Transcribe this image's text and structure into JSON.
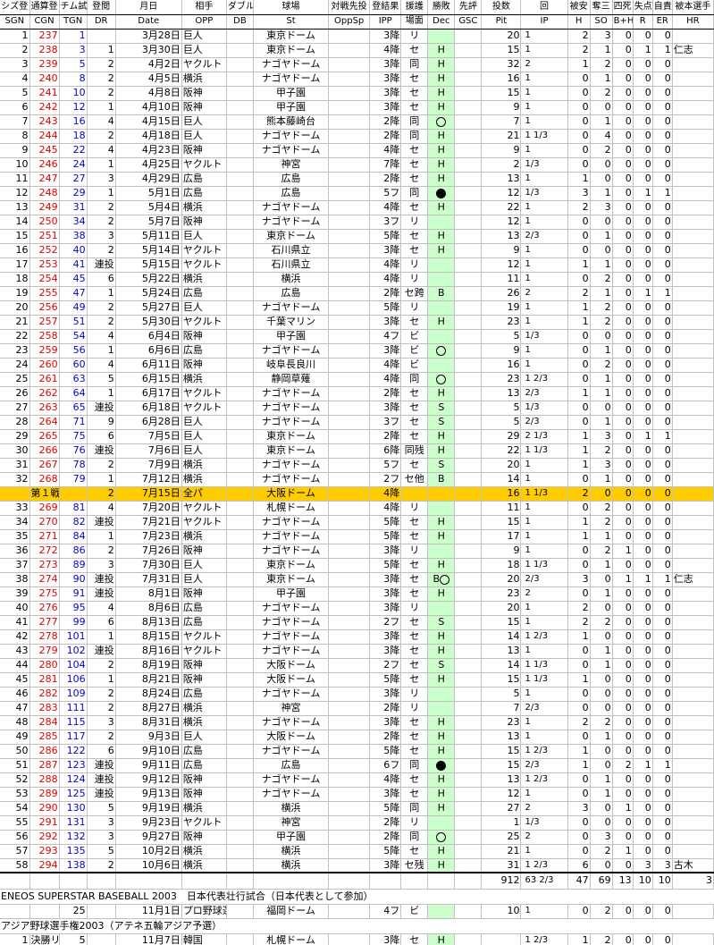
{
  "headers_top": [
    "シズ登",
    "通算登",
    "チム試",
    "登閲",
    "月日",
    "相手",
    "ダブル",
    "球場",
    "対戦先投",
    "登結果",
    "援護",
    "勝敗",
    "先評",
    "投数",
    "回",
    "被安",
    "奪三",
    "四死",
    "失点",
    "自責",
    "被本選手"
  ],
  "headers_bottom": [
    "SGN",
    "CGN",
    "TGN",
    "DR",
    "Date",
    "OPP",
    "DB",
    "St",
    "OppSp",
    "IPP",
    "場面",
    "Dec",
    "GSC",
    "Pit",
    "IP",
    "H",
    "SO",
    "B+H",
    "R",
    "ER",
    "HR"
  ],
  "rows": [
    [
      "1",
      "237",
      "1",
      "",
      "3月28日",
      "巨人",
      "",
      "東京ドーム",
      "",
      "3降",
      "リ",
      "",
      "",
      "20",
      "1",
      "2",
      "3",
      "0",
      "0",
      "0",
      ""
    ],
    [
      "2",
      "238",
      "3",
      "1",
      "3月30日",
      "巨人",
      "",
      "東京ドーム",
      "",
      "4降",
      "セ",
      "H",
      "",
      "15",
      "1",
      "2",
      "1",
      "0",
      "1",
      "1",
      "仁志"
    ],
    [
      "3",
      "239",
      "5",
      "2",
      "4月2日",
      "ヤクルト",
      "",
      "ナゴヤドーム",
      "",
      "3降",
      "同",
      "H",
      "",
      "32",
      "2",
      "1",
      "2",
      "0",
      "0",
      "0",
      ""
    ],
    [
      "4",
      "240",
      "8",
      "2",
      "4月5日",
      "横浜",
      "",
      "ナゴヤドーム",
      "",
      "3降",
      "セ",
      "H",
      "",
      "16",
      "1",
      "0",
      "1",
      "0",
      "0",
      "0",
      ""
    ],
    [
      "5",
      "241",
      "10",
      "2",
      "4月8日",
      "阪神",
      "",
      "甲子園",
      "",
      "3降",
      "セ",
      "H",
      "",
      "15",
      "1",
      "0",
      "2",
      "0",
      "0",
      "0",
      ""
    ],
    [
      "6",
      "242",
      "12",
      "1",
      "4月10日",
      "阪神",
      "",
      "甲子園",
      "",
      "3降",
      "セ",
      "H",
      "",
      "9",
      "1",
      "0",
      "0",
      "0",
      "0",
      "0",
      ""
    ],
    [
      "7",
      "243",
      "16",
      "4",
      "4月15日",
      "巨人",
      "",
      "熊本藤崎台",
      "",
      "2降",
      "同",
      "○",
      "",
      "7",
      "1",
      "0",
      "1",
      "0",
      "0",
      "0",
      ""
    ],
    [
      "8",
      "244",
      "18",
      "2",
      "4月18日",
      "巨人",
      "",
      "ナゴヤドーム",
      "",
      "2降",
      "同",
      "H",
      "",
      "21",
      "1 1/3",
      "0",
      "4",
      "0",
      "0",
      "0",
      ""
    ],
    [
      "9",
      "245",
      "22",
      "4",
      "4月23日",
      "阪神",
      "",
      "ナゴヤドーム",
      "",
      "4降",
      "セ",
      "H",
      "",
      "9",
      "1",
      "0",
      "2",
      "0",
      "0",
      "0",
      ""
    ],
    [
      "10",
      "246",
      "24",
      "1",
      "4月25日",
      "ヤクルト",
      "",
      "神宮",
      "",
      "7降",
      "セ",
      "H",
      "",
      "2",
      "1/3",
      "0",
      "0",
      "0",
      "0",
      "0",
      ""
    ],
    [
      "11",
      "247",
      "27",
      "3",
      "4月29日",
      "広島",
      "",
      "広島",
      "",
      "2降",
      "セ",
      "H",
      "",
      "13",
      "1",
      "1",
      "0",
      "0",
      "0",
      "0",
      ""
    ],
    [
      "12",
      "248",
      "29",
      "1",
      "5月1日",
      "広島",
      "",
      "広島",
      "",
      "5フ",
      "同",
      "●",
      "",
      "12",
      "1/3",
      "3",
      "1",
      "0",
      "1",
      "1",
      ""
    ],
    [
      "13",
      "249",
      "31",
      "2",
      "5月4日",
      "横浜",
      "",
      "ナゴヤドーム",
      "",
      "4降",
      "セ",
      "H",
      "",
      "22",
      "1",
      "2",
      "3",
      "0",
      "0",
      "0",
      ""
    ],
    [
      "14",
      "250",
      "34",
      "2",
      "5月7日",
      "阪神",
      "",
      "ナゴヤドーム",
      "",
      "3フ",
      "リ",
      "",
      "",
      "12",
      "1",
      "0",
      "0",
      "0",
      "0",
      "0",
      ""
    ],
    [
      "15",
      "251",
      "38",
      "3",
      "5月11日",
      "巨人",
      "",
      "東京ドーム",
      "",
      "5降",
      "セ",
      "H",
      "",
      "13",
      "2/3",
      "0",
      "1",
      "0",
      "0",
      "0",
      ""
    ],
    [
      "16",
      "252",
      "40",
      "2",
      "5月14日",
      "ヤクルト",
      "",
      "石川県立",
      "",
      "3降",
      "セ",
      "H",
      "",
      "9",
      "1",
      "0",
      "0",
      "0",
      "0",
      "0",
      ""
    ],
    [
      "17",
      "253",
      "41",
      "連投",
      "5月15日",
      "ヤクルト",
      "",
      "石川県立",
      "",
      "4降",
      "リ",
      "",
      "",
      "12",
      "1",
      "1",
      "1",
      "0",
      "0",
      "0",
      ""
    ],
    [
      "18",
      "254",
      "45",
      "6",
      "5月22日",
      "横浜",
      "",
      "横浜",
      "",
      "4降",
      "リ",
      "",
      "",
      "11",
      "1",
      "0",
      "2",
      "0",
      "0",
      "0",
      ""
    ],
    [
      "19",
      "255",
      "47",
      "1",
      "5月24日",
      "広島",
      "",
      "広島",
      "",
      "2降",
      "セ跨",
      "B",
      "",
      "26",
      "2",
      "2",
      "1",
      "0",
      "1",
      "1",
      ""
    ],
    [
      "20",
      "256",
      "49",
      "2",
      "5月27日",
      "巨人",
      "",
      "ナゴヤドーム",
      "",
      "5降",
      "リ",
      "",
      "",
      "19",
      "1",
      "1",
      "2",
      "0",
      "0",
      "0",
      ""
    ],
    [
      "21",
      "257",
      "51",
      "2",
      "5月30日",
      "ヤクルト",
      "",
      "千葉マリン",
      "",
      "3降",
      "セ",
      "H",
      "",
      "23",
      "1",
      "1",
      "2",
      "0",
      "0",
      "0",
      ""
    ],
    [
      "22",
      "258",
      "54",
      "4",
      "6月4日",
      "阪神",
      "",
      "甲子園",
      "",
      "4フ",
      "ビ",
      "",
      "",
      "5",
      "1/3",
      "0",
      "0",
      "0",
      "0",
      "0",
      ""
    ],
    [
      "23",
      "259",
      "56",
      "1",
      "6月6日",
      "広島",
      "",
      "ナゴヤドーム",
      "",
      "3降",
      "ビ",
      "○",
      "",
      "9",
      "1",
      "0",
      "1",
      "0",
      "0",
      "0",
      ""
    ],
    [
      "24",
      "260",
      "60",
      "4",
      "6月11日",
      "阪神",
      "",
      "岐阜長良川",
      "",
      "4降",
      "ビ",
      "",
      "",
      "16",
      "1",
      "0",
      "2",
      "0",
      "0",
      "0",
      ""
    ],
    [
      "25",
      "261",
      "63",
      "5",
      "6月15日",
      "横浜",
      "",
      "静岡草薙",
      "",
      "4降",
      "同",
      "○",
      "",
      "23",
      "1 2/3",
      "0",
      "1",
      "0",
      "0",
      "0",
      ""
    ],
    [
      "26",
      "262",
      "64",
      "1",
      "6月17日",
      "ヤクルト",
      "",
      "ナゴヤドーム",
      "",
      "2降",
      "セ",
      "H",
      "",
      "13",
      "2/3",
      "1",
      "1",
      "0",
      "0",
      "0",
      ""
    ],
    [
      "27",
      "263",
      "65",
      "連投",
      "6月18日",
      "ヤクルト",
      "",
      "ナゴヤドーム",
      "",
      "3降",
      "セ",
      "S",
      "",
      "5",
      "1/3",
      "0",
      "0",
      "0",
      "0",
      "0",
      ""
    ],
    [
      "28",
      "264",
      "71",
      "9",
      "6月28日",
      "巨人",
      "",
      "ナゴヤドーム",
      "",
      "3フ",
      "セ",
      "S",
      "",
      "5",
      "2/3",
      "0",
      "1",
      "0",
      "0",
      "0",
      ""
    ],
    [
      "29",
      "265",
      "75",
      "6",
      "7月5日",
      "巨人",
      "",
      "東京ドーム",
      "",
      "2降",
      "セ",
      "H",
      "",
      "29",
      "2 1/3",
      "1",
      "3",
      "0",
      "1",
      "1",
      ""
    ],
    [
      "30",
      "266",
      "76",
      "連投",
      "7月6日",
      "巨人",
      "",
      "東京ドーム",
      "",
      "6降",
      "同残",
      "H",
      "",
      "22",
      "1 1/3",
      "1",
      "2",
      "0",
      "0",
      "0",
      ""
    ],
    [
      "31",
      "267",
      "78",
      "2",
      "7月9日",
      "横浜",
      "",
      "ナゴヤドーム",
      "",
      "5フ",
      "セ",
      "S",
      "",
      "20",
      "1",
      "1",
      "3",
      "0",
      "0",
      "0",
      ""
    ],
    [
      "32",
      "268",
      "79",
      "1",
      "7月12日",
      "横浜",
      "",
      "ナゴヤドーム",
      "",
      "2フ",
      "セ他",
      "B",
      "",
      "14",
      "1",
      "0",
      "1",
      "0",
      "0",
      "0",
      ""
    ]
  ],
  "allstar": [
    "",
    "第１戦",
    "",
    "2",
    "7月15日",
    "全パ",
    "",
    "大阪ドーム",
    "",
    "4降",
    "",
    "",
    "",
    "16",
    "1 1/3",
    "2",
    "0",
    "0",
    "0",
    "0",
    ""
  ],
  "rows2": [
    [
      "33",
      "269",
      "81",
      "4",
      "7月20日",
      "ヤクルト",
      "",
      "札幌ドーム",
      "",
      "4降",
      "リ",
      "",
      "",
      "11",
      "1",
      "0",
      "2",
      "0",
      "0",
      "0",
      ""
    ],
    [
      "34",
      "270",
      "82",
      "連投",
      "7月21日",
      "ヤクルト",
      "",
      "ナゴヤドーム",
      "",
      "5降",
      "セ",
      "H",
      "",
      "15",
      "1",
      "1",
      "2",
      "0",
      "0",
      "0",
      ""
    ],
    [
      "35",
      "271",
      "84",
      "1",
      "7月23日",
      "横浜",
      "",
      "ナゴヤドーム",
      "",
      "5降",
      "セ",
      "H",
      "",
      "17",
      "1",
      "1",
      "1",
      "0",
      "0",
      "0",
      ""
    ],
    [
      "36",
      "272",
      "86",
      "2",
      "7月26日",
      "阪神",
      "",
      "ナゴヤドーム",
      "",
      "3降",
      "リ",
      "",
      "",
      "9",
      "1",
      "0",
      "2",
      "1",
      "0",
      "0",
      ""
    ],
    [
      "37",
      "273",
      "89",
      "3",
      "7月30日",
      "巨人",
      "",
      "東京ドーム",
      "",
      "5降",
      "セ",
      "H",
      "",
      "18",
      "1 1/3",
      "0",
      "1",
      "0",
      "0",
      "0",
      ""
    ],
    [
      "38",
      "274",
      "90",
      "連投",
      "7月31日",
      "巨人",
      "",
      "東京ドーム",
      "",
      "3降",
      "セ",
      "B○",
      "",
      "20",
      "2/3",
      "3",
      "0",
      "1",
      "1",
      "1",
      "仁志"
    ],
    [
      "39",
      "275",
      "91",
      "連投",
      "8月1日",
      "阪神",
      "",
      "甲子園",
      "",
      "3降",
      "セ",
      "H",
      "",
      "23",
      "2",
      "0",
      "1",
      "0",
      "0",
      "0",
      ""
    ],
    [
      "40",
      "276",
      "95",
      "4",
      "8月6日",
      "広島",
      "",
      "ナゴヤドーム",
      "",
      "3降",
      "リ",
      "",
      "",
      "20",
      "1",
      "2",
      "0",
      "0",
      "0",
      "0",
      ""
    ],
    [
      "41",
      "277",
      "99",
      "6",
      "8月13日",
      "広島",
      "",
      "ナゴヤドーム",
      "",
      "2フ",
      "セ",
      "S",
      "",
      "15",
      "1",
      "2",
      "2",
      "0",
      "0",
      "0",
      ""
    ],
    [
      "42",
      "278",
      "101",
      "1",
      "8月15日",
      "ヤクルト",
      "",
      "ナゴヤドーム",
      "",
      "3降",
      "セ",
      "H",
      "",
      "14",
      "1 2/3",
      "1",
      "0",
      "0",
      "0",
      "0",
      ""
    ],
    [
      "43",
      "279",
      "102",
      "連投",
      "8月16日",
      "ヤクルト",
      "",
      "ナゴヤドーム",
      "",
      "3降",
      "セ",
      "H",
      "",
      "13",
      "1",
      "0",
      "1",
      "0",
      "0",
      "0",
      ""
    ],
    [
      "44",
      "280",
      "104",
      "2",
      "8月19日",
      "阪神",
      "",
      "大阪ドーム",
      "",
      "2フ",
      "セ",
      "S",
      "",
      "14",
      "1 1/3",
      "0",
      "1",
      "0",
      "0",
      "0",
      ""
    ],
    [
      "45",
      "281",
      "106",
      "1",
      "8月21日",
      "阪神",
      "",
      "大阪ドーム",
      "",
      "5降",
      "セ",
      "H",
      "",
      "15",
      "1 1/3",
      "1",
      "0",
      "0",
      "0",
      "0",
      ""
    ],
    [
      "46",
      "282",
      "109",
      "2",
      "8月24日",
      "広島",
      "",
      "ナゴヤドーム",
      "",
      "3降",
      "リ",
      "",
      "",
      "5",
      "1",
      "0",
      "0",
      "0",
      "0",
      "0",
      ""
    ],
    [
      "47",
      "283",
      "111",
      "2",
      "8月27日",
      "横浜",
      "",
      "神宮",
      "",
      "2降",
      "リ",
      "",
      "",
      "7",
      "2/3",
      "0",
      "0",
      "0",
      "0",
      "0",
      ""
    ],
    [
      "48",
      "284",
      "115",
      "3",
      "8月31日",
      "横浜",
      "",
      "ナゴヤドーム",
      "",
      "3降",
      "セ",
      "H",
      "",
      "23",
      "1",
      "2",
      "2",
      "0",
      "0",
      "0",
      ""
    ],
    [
      "49",
      "285",
      "117",
      "2",
      "9月3日",
      "巨人",
      "",
      "大阪ドーム",
      "",
      "2降",
      "セ",
      "H",
      "",
      "13",
      "1",
      "0",
      "1",
      "0",
      "0",
      "0",
      ""
    ],
    [
      "50",
      "286",
      "122",
      "6",
      "9月10日",
      "広島",
      "",
      "ナゴヤドーム",
      "",
      "5降",
      "セ",
      "H",
      "",
      "15",
      "1 2/3",
      "1",
      "0",
      "0",
      "0",
      "0",
      ""
    ],
    [
      "51",
      "287",
      "123",
      "連投",
      "9月11日",
      "広島",
      "",
      "広島",
      "",
      "6フ",
      "同",
      "●",
      "",
      "15",
      "2/3",
      "1",
      "0",
      "2",
      "1",
      "1",
      ""
    ],
    [
      "52",
      "288",
      "124",
      "連投",
      "9月12日",
      "阪神",
      "",
      "ナゴヤドーム",
      "",
      "4降",
      "セ",
      "H",
      "",
      "13",
      "1 2/3",
      "0",
      "1",
      "0",
      "0",
      "0",
      ""
    ],
    [
      "53",
      "289",
      "125",
      "連投",
      "9月13日",
      "阪神",
      "",
      "ナゴヤドーム",
      "",
      "3降",
      "セ",
      "H",
      "",
      "12",
      "1",
      "0",
      "1",
      "0",
      "0",
      "0",
      ""
    ],
    [
      "54",
      "290",
      "130",
      "5",
      "9月19日",
      "横浜",
      "",
      "横浜",
      "",
      "5降",
      "同",
      "H",
      "",
      "27",
      "2",
      "3",
      "0",
      "1",
      "0",
      "0",
      ""
    ],
    [
      "55",
      "291",
      "131",
      "3",
      "9月23日",
      "ヤクルト",
      "",
      "神宮",
      "",
      "2降",
      "リ",
      "",
      "",
      "1",
      "1/3",
      "0",
      "0",
      "0",
      "0",
      "0",
      ""
    ],
    [
      "56",
      "292",
      "132",
      "3",
      "9月27日",
      "阪神",
      "",
      "甲子園",
      "",
      "2降",
      "同",
      "○",
      "",
      "25",
      "2",
      "0",
      "3",
      "0",
      "0",
      "0",
      ""
    ],
    [
      "57",
      "293",
      "135",
      "5",
      "10月2日",
      "横浜",
      "",
      "横浜",
      "",
      "5降",
      "セ",
      "H",
      "",
      "21",
      "1",
      "0",
      "2",
      "1",
      "0",
      "0",
      ""
    ],
    [
      "58",
      "294",
      "138",
      "2",
      "10月6日",
      "横浜",
      "",
      "横浜",
      "",
      "3降",
      "セ残",
      "H",
      "",
      "31",
      "1 2/3",
      "6",
      "0",
      "0",
      "3",
      "3",
      "古木"
    ]
  ],
  "totals": [
    "912",
    "63 2/3",
    "47",
    "69",
    "13",
    "10",
    "10",
    "3"
  ],
  "section1_title": "ENEOS SUPERSTAR BASEBALL 2003　日本代表壮行試合（日本代表として参加）",
  "section1_row": [
    "",
    "",
    "25",
    "",
    "11月1日",
    "プロ野球選抜",
    "",
    "福岡ドーム",
    "",
    "4フ",
    "ビ",
    "",
    "",
    "10",
    "1",
    "0",
    "2",
    "0",
    "0",
    "0",
    ""
  ],
  "section2_title": "アジア野球選手権2003（アテネ五輪アジア予選）",
  "section2_row": [
    "1",
    "決勝リーグ",
    "5",
    "",
    "11月7日",
    "韓国",
    "",
    "札幌ドーム",
    "",
    "3降",
    "セ",
    "H",
    "",
    "",
    "1 2/3",
    "1",
    "2",
    "0",
    "0",
    "0",
    ""
  ]
}
